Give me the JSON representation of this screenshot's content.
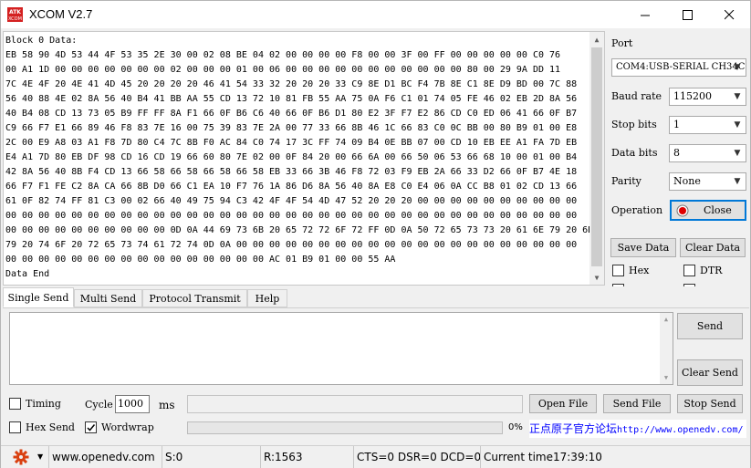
{
  "window": {
    "title": "XCOM V2.7",
    "icon_text": "ATK\nXCOM"
  },
  "receive": {
    "lines": [
      "Block 0 Data:",
      "EB 58 90 4D 53 44 4F 53 35 2E 30 00 02 08 BE 04 02 00 00 00 00 F8 00 00 3F 00 FF 00 00 00 00 00 C0 76",
      "00 A1 1D 00 00 00 00 00 00 00 02 00 00 00 01 00 06 00 00 00 00 00 00 00 00 00 00 00 80 00 29 9A DD 11",
      "7C 4E 4F 20 4E 41 4D 45 20 20 20 20 46 41 54 33 32 20 20 20 33 C9 8E D1 BC F4 7B 8E C1 8E D9 BD 00 7C 88",
      "56 40 88 4E 02 8A 56 40 B4 41 BB AA 55 CD 13 72 10 81 FB 55 AA 75 0A F6 C1 01 74 05 FE 46 02 EB 2D 8A 56",
      "40 B4 08 CD 13 73 05 B9 FF FF 8A F1 66 0F B6 C6 40 66 0F B6 D1 80 E2 3F F7 E2 86 CD C0 ED 06 41 66 0F B7",
      "C9 66 F7 E1 66 89 46 F8 83 7E 16 00 75 39 83 7E 2A 00 77 33 66 8B 46 1C 66 83 C0 0C BB 00 80 B9 01 00 E8",
      "2C 00 E9 A8 03 A1 F8 7D 80 C4 7C 8B F0 AC 84 C0 74 17 3C FF 74 09 B4 0E BB 07 00 CD 10 EB EE A1 FA 7D EB",
      "E4 A1 7D 80 EB DF 98 CD 16 CD 19 66 60 80 7E 02 00 0F 84 20 00 66 6A 00 66 50 06 53 66 68 10 00 01 00 B4",
      "42 8A 56 40 8B F4 CD 13 66 58 66 58 66 58 66 58 EB 33 66 3B 46 F8 72 03 F9 EB 2A 66 33 D2 66 0F B7 4E 18",
      "66 F7 F1 FE C2 8A CA 66 8B D0 66 C1 EA 10 F7 76 1A 86 D6 8A 56 40 8A E8 C0 E4 06 0A CC B8 01 02 CD 13 66",
      "61 0F 82 74 FF 81 C3 00 02 66 40 49 75 94 C3 42 4F 4F 54 4D 47 52 20 20 20 00 00 00 00 00 00 00 00 00 00",
      "00 00 00 00 00 00 00 00 00 00 00 00 00 00 00 00 00 00 00 00 00 00 00 00 00 00 00 00 00 00 00 00 00 00 00",
      "00 00 00 00 00 00 00 00 00 00 0D 0A 44 69 73 6B 20 65 72 72 6F 72 FF 0D 0A 50 72 65 73 73 20 61 6E 79 20 6B 65",
      "79 20 74 6F 20 72 65 73 74 61 72 74 0D 0A 00 00 00 00 00 00 00 00 00 00 00 00 00 00 00 00 00 00 00 00 00",
      "00 00 00 00 00 00 00 00 00 00 00 00 00 00 00 00 AC 01 B9 01 00 00 55 AA",
      "Data End"
    ]
  },
  "settings": {
    "port_label": "Port",
    "port_value": "COM4:USB-SERIAL CH34C",
    "baud_label": "Baud rate",
    "baud_value": "115200",
    "stop_label": "Stop bits",
    "stop_value": "1",
    "data_label": "Data bits",
    "data_value": "8",
    "parity_label": "Parity",
    "parity_value": "None",
    "operation_label": "Operation",
    "operation_button": "Close",
    "save_data": "Save Data",
    "clear_data": "Clear Data",
    "hex_label": "Hex",
    "dtr_label": "DTR"
  },
  "tabs": [
    "Single Send",
    "Multi Send",
    "Protocol Transmit",
    "Help"
  ],
  "send": {
    "send_button": "Send",
    "clear_send_button": "Clear Send",
    "timing_label": "Timing",
    "cycle_label": "Cycle",
    "cycle_value": "1000",
    "ms_label": "ms",
    "hex_send_label": "Hex Send",
    "wordwrap_label": "Wordwrap",
    "open_file_button": "Open File",
    "send_file_button": "Send File",
    "stop_send_button": "Stop Send",
    "progress_text": "0%",
    "progress_fraction": 0,
    "promo_cn": "正点原子官方论坛",
    "promo_url": "http://www.openedv.com/"
  },
  "status": {
    "url": "www.openedv.com",
    "sent": "S:0",
    "received": "R:1563",
    "lines": "CTS=0 DSR=0 DCD=0",
    "time": "Current time17:39:10"
  },
  "colors": {
    "accent": "#0078d7",
    "progress": "#06b025",
    "promo_url": "#0000ff",
    "record": "#e00000"
  }
}
